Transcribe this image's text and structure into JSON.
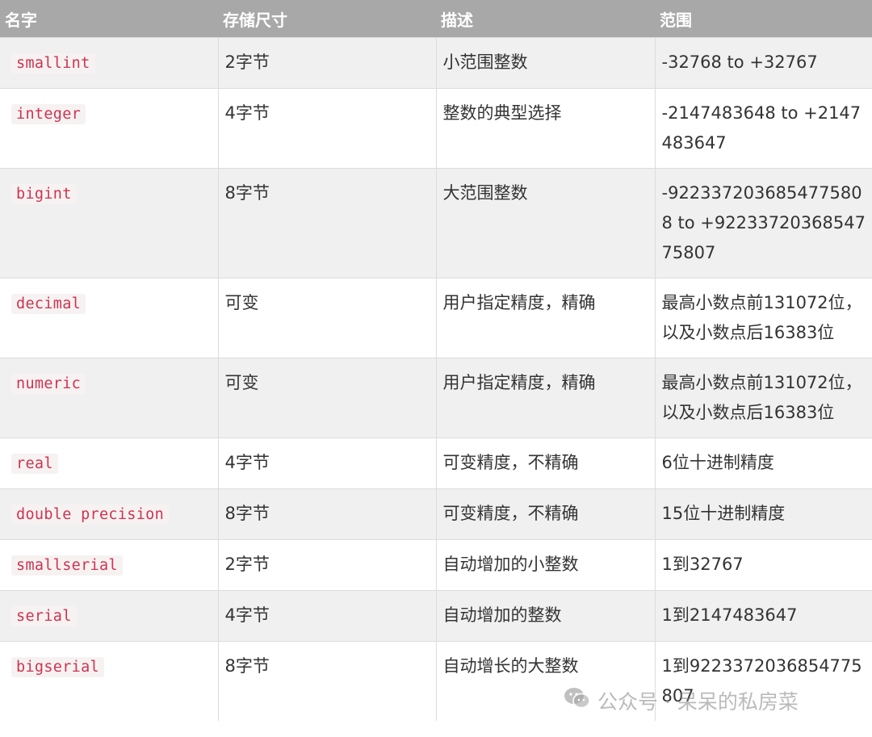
{
  "table": {
    "headers": [
      "名字",
      "存储尺寸",
      "描述",
      "范围"
    ],
    "rows": [
      {
        "name": "smallint",
        "size": "2字节",
        "desc": "小范围整数",
        "range": "-32768 to +32767"
      },
      {
        "name": "integer",
        "size": "4字节",
        "desc": "整数的典型选择",
        "range": "-2147483648 to +2147483647"
      },
      {
        "name": "bigint",
        "size": "8字节",
        "desc": "大范围整数",
        "range": "-9223372036854775808 to +9223372036854775807"
      },
      {
        "name": "decimal",
        "size": "可变",
        "desc": "用户指定精度，精确",
        "range": "最高小数点前131072位，以及小数点后16383位"
      },
      {
        "name": "numeric",
        "size": "可变",
        "desc": "用户指定精度，精确",
        "range": "最高小数点前131072位，以及小数点后16383位"
      },
      {
        "name": "real",
        "size": "4字节",
        "desc": "可变精度，不精确",
        "range": "6位十进制精度"
      },
      {
        "name": "double precision",
        "size": "8字节",
        "desc": "可变精度，不精确",
        "range": "15位十进制精度"
      },
      {
        "name": "smallserial",
        "size": "2字节",
        "desc": "自动增加的小整数",
        "range": "1到32767"
      },
      {
        "name": "serial",
        "size": "4字节",
        "desc": "自动增加的整数",
        "range": "1到2147483647"
      },
      {
        "name": "bigserial",
        "size": "8字节",
        "desc": "自动增长的大整数",
        "range": "1到9223372036854775807"
      }
    ]
  },
  "watermark": {
    "text": "公众号 · 呆呆的私房菜",
    "icon": "wechat-icon"
  }
}
